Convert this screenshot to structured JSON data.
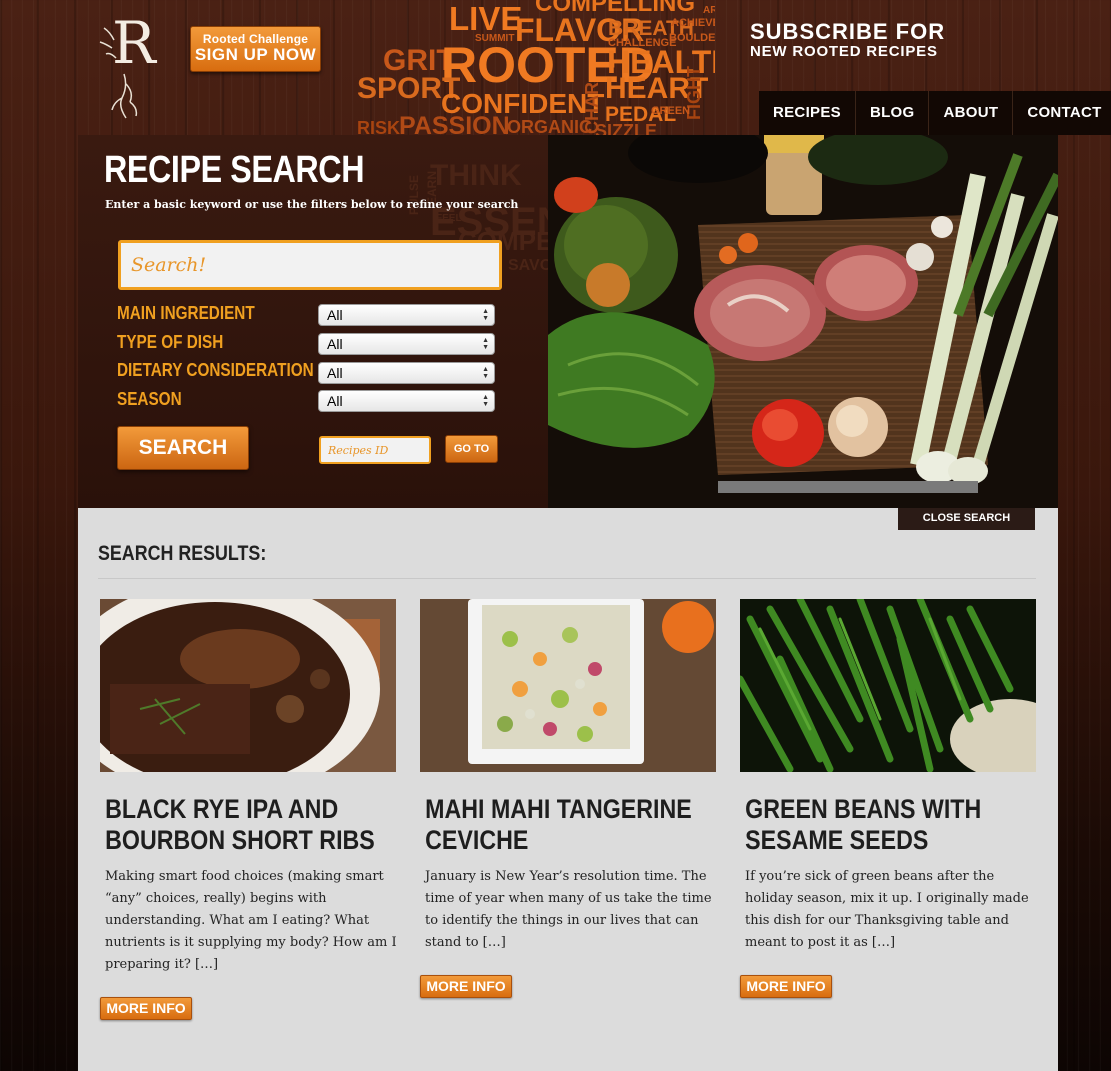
{
  "header": {
    "logo_letter": "R",
    "challenge": {
      "small": "Rooted Challenge",
      "big": "SIGN UP NOW"
    },
    "subscribe": {
      "line1": "SUBSCRIBE FOR",
      "line2": "NEW ROOTED RECIPES"
    },
    "word_cloud": [
      "COMPELLING",
      "LIVE",
      "SUMMIT",
      "FLAVOR",
      "BREATH",
      "ACHIEVE",
      "ART",
      "CHALLENGE",
      "BOULDER",
      "GRIT",
      "ROOTED",
      "HEALTHY",
      "SPORT",
      "HEART",
      "CONFIDENT",
      "FIGHT",
      "PEDAL",
      "GREEN",
      "CHAR",
      "RISK",
      "PASSION",
      "ORGANIC",
      "SIZZLE"
    ]
  },
  "nav": {
    "items": [
      "RECIPES",
      "BLOG",
      "ABOUT",
      "CONTACT"
    ]
  },
  "search_panel": {
    "title": "RECIPE SEARCH",
    "subtitle": "Enter a basic keyword or use the filters below to refine your search",
    "search_placeholder": "Search!",
    "filters": [
      {
        "label": "MAIN INGREDIENT",
        "value": "All"
      },
      {
        "label": "TYPE OF DISH",
        "value": "All"
      },
      {
        "label": "DIETARY CONSIDERATION",
        "value": "All"
      },
      {
        "label": "SEASON",
        "value": "All"
      }
    ],
    "search_button": "SEARCH",
    "recipe_id_placeholder": "Recipes ID",
    "goto_button": "GO TO",
    "background_words": [
      "THINK",
      "PULSE",
      "ESSENCE",
      "COMPETE",
      "SAVOR",
      "EARN",
      "FEEL"
    ]
  },
  "results": {
    "close_label": "CLOSE SEARCH",
    "title": "SEARCH RESULTS:",
    "more_label": "MORE INFO",
    "items": [
      {
        "title": "BLACK RYE IPA AND BOURBON SHORT RIBS",
        "desc": "Making smart food choices (making smart “any” choices, really) begins with understanding.  What am I eating?  What nutrients is it supplying my body?  How am I preparing it?  […]"
      },
      {
        "title": "MAHI MAHI TANGERINE CEVICHE",
        "desc": "January is New Year’s resolution time.  The time of year when many of us take the time to identify the things in our lives that can stand to […]"
      },
      {
        "title": "GREEN BEANS WITH SESAME SEEDS",
        "desc": "If you’re sick of green beans after the holiday season, mix it up.  I originally made this dish for our Thanksgiving table and meant to post it as […]"
      }
    ]
  },
  "colors": {
    "accent_orange": "#e8861e",
    "panel_dark": "#2a120a",
    "results_bg": "#dcdcdc"
  }
}
